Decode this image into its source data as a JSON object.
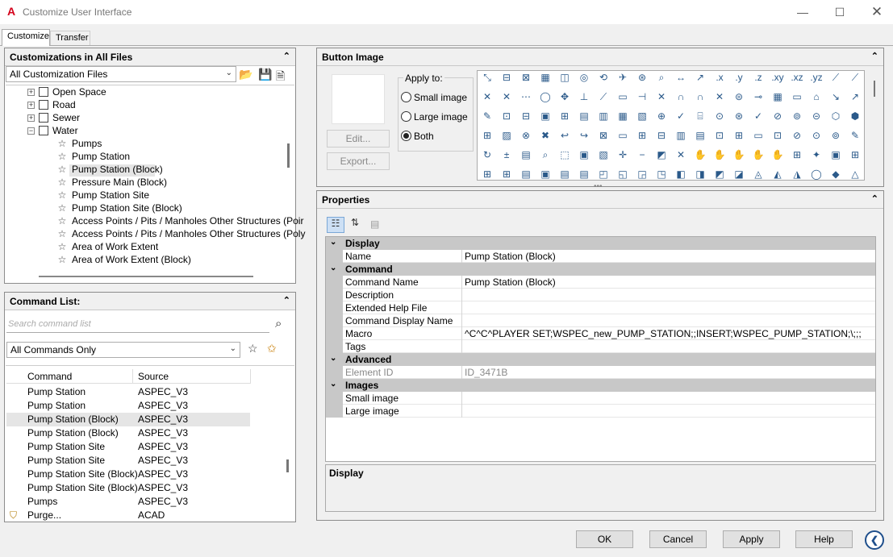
{
  "window": {
    "title": "Customize User Interface",
    "logo": "A"
  },
  "tabs": [
    "Customize",
    "Transfer"
  ],
  "customizations": {
    "header": "Customizations in All Files",
    "file_combo": "All Customization Files",
    "tree": [
      {
        "label": "Open Space",
        "type": "folder"
      },
      {
        "label": "Road",
        "type": "folder"
      },
      {
        "label": "Sewer",
        "type": "folder"
      },
      {
        "label": "Water",
        "type": "folder-open"
      },
      {
        "label": "Pumps",
        "type": "command"
      },
      {
        "label": "Pump Station",
        "type": "command"
      },
      {
        "label": "Pump Station (Block)",
        "type": "command",
        "selected": true
      },
      {
        "label": "Pressure Main (Block)",
        "type": "command"
      },
      {
        "label": "Pump Station Site",
        "type": "command"
      },
      {
        "label": "Pump Station Site (Block)",
        "type": "command"
      },
      {
        "label": "Access Points / Pits / Manholes  Other Structures (Poir",
        "type": "command"
      },
      {
        "label": "Access Points / Pits / Manholes  Other Structures (Poly",
        "type": "command"
      },
      {
        "label": "Area of Work Extent",
        "type": "command"
      },
      {
        "label": "Area of Work Extent (Block)",
        "type": "command"
      }
    ]
  },
  "command_list": {
    "header": "Command List:",
    "search_placeholder": "Search command list",
    "filter": "All Commands Only",
    "columns": [
      "Command",
      "Source"
    ],
    "rows": [
      {
        "command": "Pump Station",
        "source": "ASPEC_V3"
      },
      {
        "command": "Pump Station",
        "source": "ASPEC_V3"
      },
      {
        "command": "Pump Station (Block)",
        "source": "ASPEC_V3",
        "selected": true
      },
      {
        "command": "Pump Station (Block)",
        "source": "ASPEC_V3"
      },
      {
        "command": "Pump Station Site",
        "source": "ASPEC_V3"
      },
      {
        "command": "Pump Station Site",
        "source": "ASPEC_V3"
      },
      {
        "command": "Pump Station Site (Block)",
        "source": "ASPEC_V3"
      },
      {
        "command": "Pump Station Site (Block)",
        "source": "ASPEC_V3"
      },
      {
        "command": "Pumps",
        "source": "ASPEC_V3"
      },
      {
        "command": "Purge...",
        "source": "ACAD",
        "icon": "purge-icon"
      }
    ]
  },
  "button_image": {
    "header": "Button Image",
    "edit_label": "Edit...",
    "export_label": "Export...",
    "apply_to_label": "Apply to:",
    "options": [
      "Small image",
      "Large image",
      "Both"
    ],
    "selected_option": "Both"
  },
  "properties": {
    "header": "Properties",
    "categories": [
      {
        "name": "Display",
        "rows": [
          {
            "key": "Name",
            "value": "Pump Station (Block)"
          }
        ]
      },
      {
        "name": "Command",
        "rows": [
          {
            "key": "Command Name",
            "value": "Pump Station (Block)"
          },
          {
            "key": "Description",
            "value": ""
          },
          {
            "key": "Extended Help File",
            "value": ""
          },
          {
            "key": "Command Display Name",
            "value": ""
          },
          {
            "key": "Macro",
            "value": "^C^C^PLAYER SET;WSPEC_new_PUMP_STATION;;INSERT;WSPEC_PUMP_STATION;\\;;;"
          },
          {
            "key": "Tags",
            "value": ""
          }
        ]
      },
      {
        "name": "Advanced",
        "rows": [
          {
            "key": "Element ID",
            "value": "ID_3471B",
            "readonly": true
          }
        ]
      },
      {
        "name": "Images",
        "rows": [
          {
            "key": "Small image",
            "value": ""
          },
          {
            "key": "Large image",
            "value": ""
          }
        ]
      }
    ],
    "description_title": "Display"
  },
  "footer": {
    "ok": "OK",
    "cancel": "Cancel",
    "apply": "Apply",
    "help": "Help"
  }
}
